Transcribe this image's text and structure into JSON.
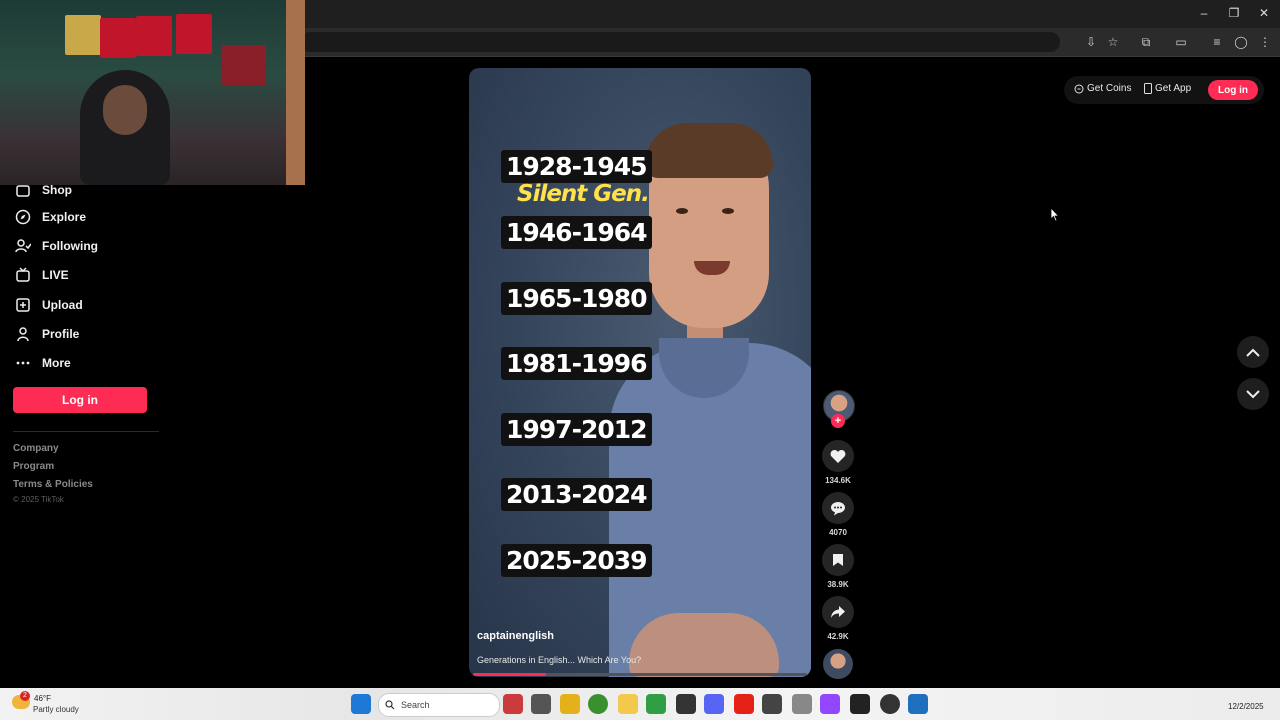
{
  "sidebar": {
    "items": [
      {
        "label": "Shop",
        "icon": "shop-icon"
      },
      {
        "label": "Explore",
        "icon": "compass-icon"
      },
      {
        "label": "Following",
        "icon": "following-icon"
      },
      {
        "label": "LIVE",
        "icon": "live-icon"
      },
      {
        "label": "Upload",
        "icon": "upload-icon"
      },
      {
        "label": "Profile",
        "icon": "profile-icon"
      },
      {
        "label": "More",
        "icon": "more-icon"
      }
    ],
    "login_label": "Log in",
    "footer_links": [
      "Company",
      "Program",
      "Terms & Policies"
    ],
    "copyright": "© 2025 TikTok"
  },
  "header": {
    "get_coins": "Get Coins",
    "get_app": "Get App",
    "login_label": "Log in"
  },
  "video": {
    "years": [
      "1928-1945",
      "1946-1964",
      "1965-1980",
      "1981-1996",
      "1997-2012",
      "2013-2024",
      "2025-2039"
    ],
    "highlight": "Silent Gen.",
    "author": "captainenglish",
    "caption": "Generations in English... Which Are You?",
    "progress": 0.22
  },
  "actions": {
    "likes": "134.6K",
    "comments": "4070",
    "saves": "38.9K",
    "shares": "42.9K"
  },
  "taskbar": {
    "weather_temp": "46°F",
    "weather_desc": "Partly cloudy",
    "notification_count": "2",
    "search_placeholder": "Search",
    "date": "12/2/2025"
  },
  "colors": {
    "accent": "#fe2c55",
    "highlight_text": "#ffe24a",
    "background": "#000000"
  }
}
